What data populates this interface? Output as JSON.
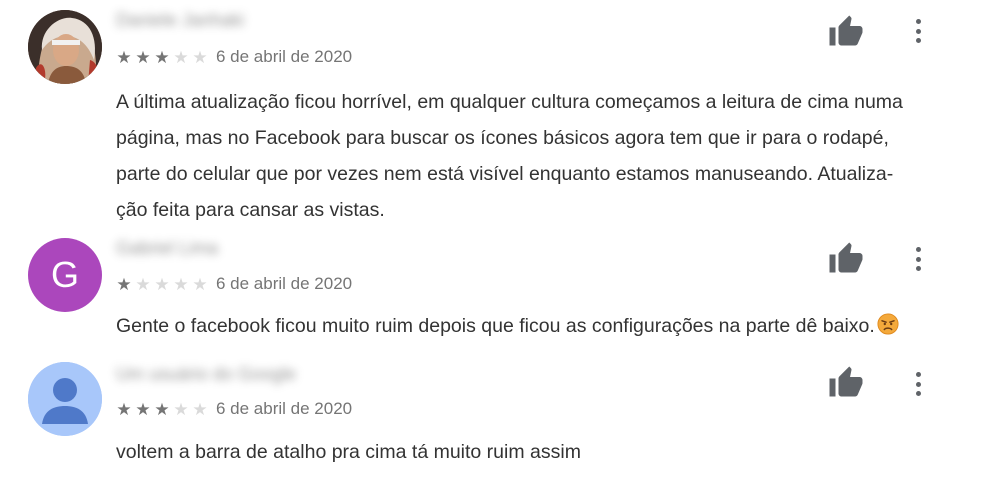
{
  "reviews": [
    {
      "author": "Daniele Janhaki",
      "avatar": "illustrated-portrait",
      "rating": 3,
      "stars_display": [
        "on",
        "on",
        "on",
        "off",
        "off"
      ],
      "date": "6 de abril de 2020",
      "text_lines": [
        "A última atualização ficou horrível, em qualquer cultura começamos a leitura de cima numa",
        "página, mas no Facebook para buscar os ícones básicos agora tem que ir para o rodapé,",
        "parte do celular que por vezes nem está visível enquanto estamos manuseando. Atualiza-",
        "ção feita para cansar as vistas."
      ]
    },
    {
      "author": "Gabriel Lima",
      "avatar": "letter",
      "avatar_letter": "G",
      "avatar_color": "#ab47bc",
      "rating": 1,
      "stars_display": [
        "on",
        "off",
        "off",
        "off",
        "off"
      ],
      "date": "6 de abril de 2020",
      "text": "Gente o facebook ficou muito ruim depois que ficou as configurações na parte dê baixo.",
      "emoji": "angry-face-emoji"
    },
    {
      "author": "Um usuário do Google",
      "avatar": "google-default-person",
      "avatar_color": "#a8c7fa",
      "rating": 3,
      "stars_display": [
        "on",
        "on",
        "on",
        "off",
        "off"
      ],
      "date": "6 de abril de 2020",
      "text": "voltem a barra de atalho pra cima tá muito ruim assim"
    }
  ],
  "icons": {
    "helpful": "thumbs-up-icon",
    "menu": "more-vertical-icon",
    "star_filled_color": "#757575",
    "star_empty_color": "#dadada",
    "icon_color": "#5f6368"
  },
  "star_glyph": "★"
}
